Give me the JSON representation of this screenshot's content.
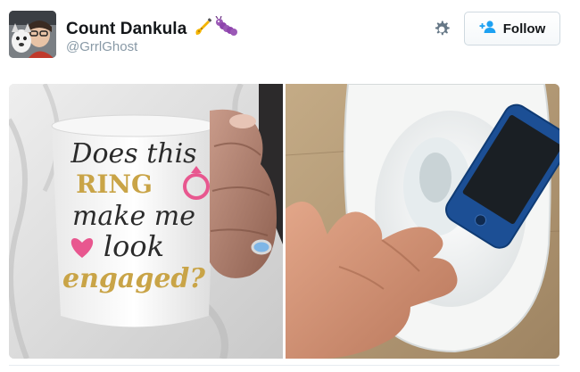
{
  "tweet": {
    "display_name": "Count Dankula",
    "handle": "@GrrlGhost",
    "name_emojis": [
      "saxophone-emoji",
      "caterpillar-emoji"
    ],
    "follow_label": "Follow"
  },
  "media": {
    "left_image": {
      "mug_text": [
        "Does this",
        "RING",
        "make me",
        "look",
        "engaged?"
      ]
    }
  },
  "colors": {
    "text_primary": "#14171a",
    "text_secondary": "#8899a6",
    "follow_icon": "#1da1f2",
    "mug_gold": "#c9a447",
    "mug_pink": "#e8578f"
  }
}
